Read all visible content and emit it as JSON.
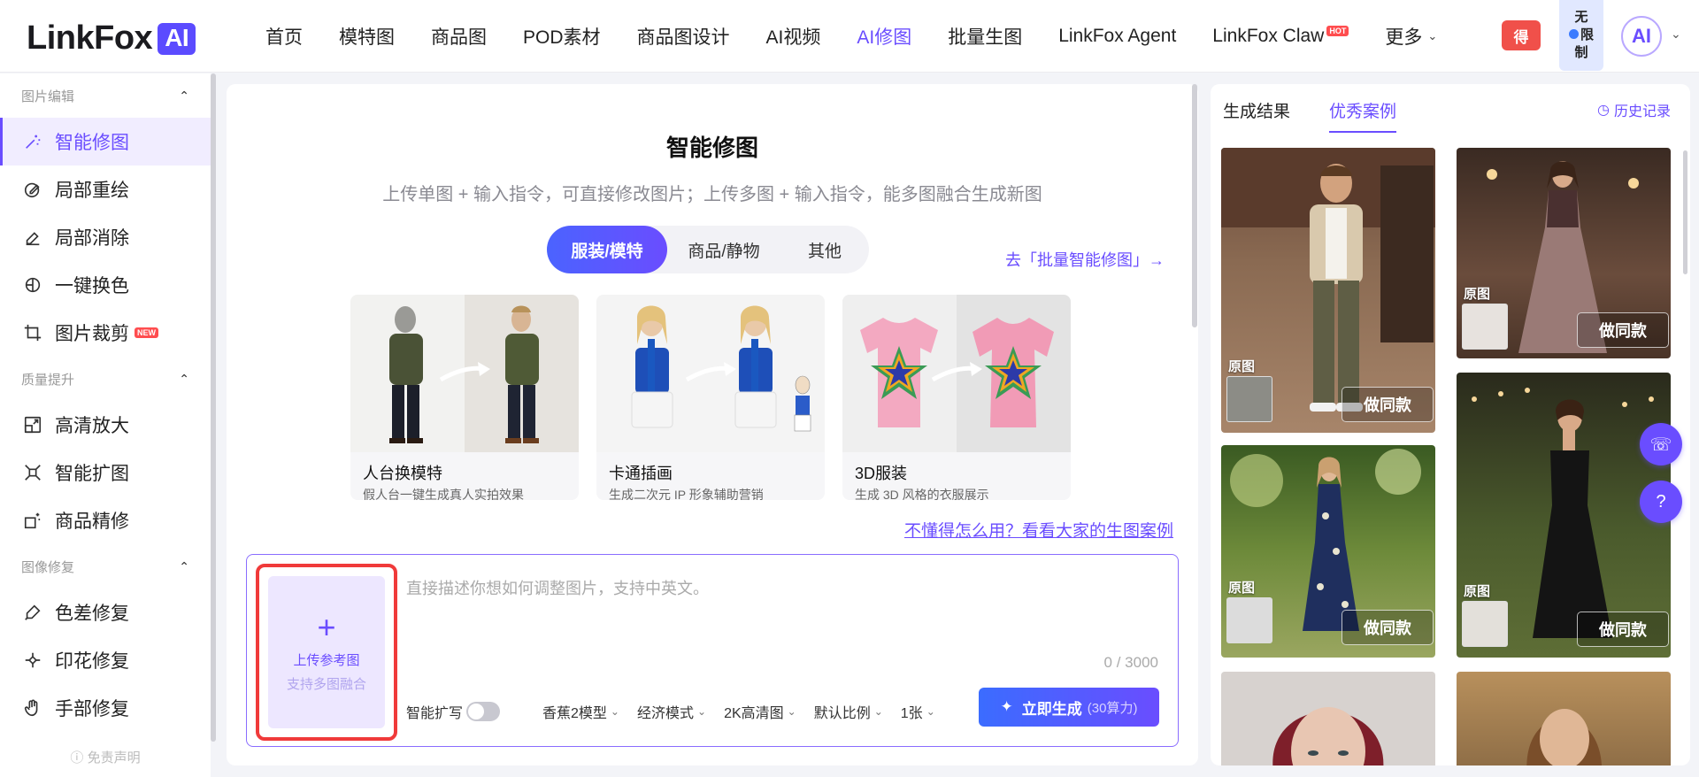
{
  "brand": {
    "name": "LinkFox",
    "badge": "AI"
  },
  "nav": {
    "items": [
      "首页",
      "模特图",
      "商品图",
      "POD素材",
      "商品图设计",
      "AI视频",
      "AI修图",
      "批量生图",
      "LinkFox Agent",
      "LinkFox Claw",
      "更多"
    ],
    "hot_badge": "HOT",
    "red_button": "得",
    "unlimited": [
      "无",
      "限",
      "制"
    ],
    "avatar": "AI"
  },
  "sidebar": {
    "groups": [
      {
        "title": "图片编辑",
        "items": [
          "智能修图",
          "局部重绘",
          "局部消除",
          "一键换色",
          "图片裁剪"
        ]
      },
      {
        "title": "质量提升",
        "items": [
          "高清放大",
          "智能扩图",
          "商品精修"
        ]
      },
      {
        "title": "图像修复",
        "items": [
          "色差修复",
          "印花修复",
          "手部修复"
        ]
      }
    ],
    "new_badge": "NEW",
    "disclaimer": "免责声明"
  },
  "main": {
    "title": "智能修图",
    "subtitle": "上传单图 + 输入指令，可直接修改图片；上传多图 + 输入指令，能多图融合生成新图",
    "tabs": [
      "服装/模特",
      "商品/静物",
      "其他"
    ],
    "batch_link": "去「批量智能修图」→",
    "cards": [
      {
        "title": "人台换模特",
        "desc": "假人台一键生成真人实拍效果"
      },
      {
        "title": "卡通插画",
        "desc": "生成二次元 IP 形象辅助营销"
      },
      {
        "title": "3D服装",
        "desc": "生成 3D 风格的衣服展示"
      }
    ],
    "help_link": "不懂得怎么用？看看大家的生图案例",
    "upload_label": "上传参考图",
    "upload_sub": "支持多图融合",
    "prompt_placeholder": "直接描述你想如何调整图片，支持中英文。",
    "counter": "0 / 3000",
    "smart_expand": "智能扩写",
    "options": [
      "香蕉2模型",
      "经济模式",
      "2K高清图",
      "默认比例",
      "1张"
    ],
    "generate_label": "立即生成",
    "generate_cost": "(30算力)"
  },
  "right": {
    "tabs": [
      "生成结果",
      "优秀案例"
    ],
    "history": "历史记录",
    "original_label": "原图",
    "same_label": "做同款"
  },
  "colors": {
    "accent": "#6a4dff",
    "highlight": "#f03a3a"
  }
}
